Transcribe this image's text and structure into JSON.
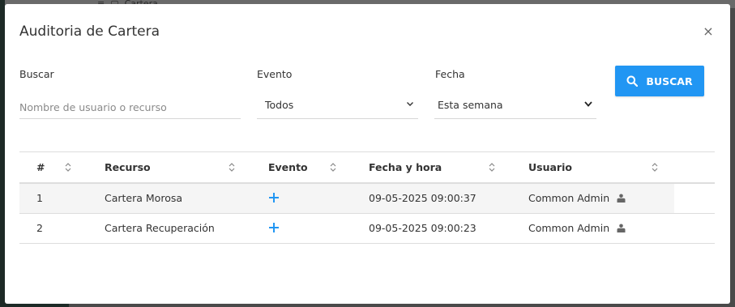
{
  "background": {
    "breadcrumb": "Cartera"
  },
  "modal": {
    "title": "Auditoria de Cartera",
    "close_label": "×"
  },
  "filters": {
    "search": {
      "label": "Buscar",
      "placeholder": "Nombre de usuario o recurso",
      "value": ""
    },
    "event": {
      "label": "Evento",
      "value": "Todos"
    },
    "date": {
      "label": "Fecha",
      "value": "Esta semana"
    },
    "search_button": "BUSCAR"
  },
  "table": {
    "headers": [
      "#",
      "Recurso",
      "Evento",
      "Fecha y hora",
      "Usuario"
    ],
    "rows": [
      {
        "num": "1",
        "resource": "Cartera Morosa",
        "event_icon": "plus-icon",
        "datetime": "09-05-2025 09:00:37",
        "user": "Common Admin",
        "user_icon": "user-icon"
      },
      {
        "num": "2",
        "resource": "Cartera Recuperación",
        "event_icon": "plus-icon",
        "datetime": "09-05-2025 09:00:23",
        "user": "Common Admin",
        "user_icon": "user-icon"
      }
    ]
  },
  "colors": {
    "accent": "#2196f3",
    "backdrop": "#4a4a4a"
  }
}
